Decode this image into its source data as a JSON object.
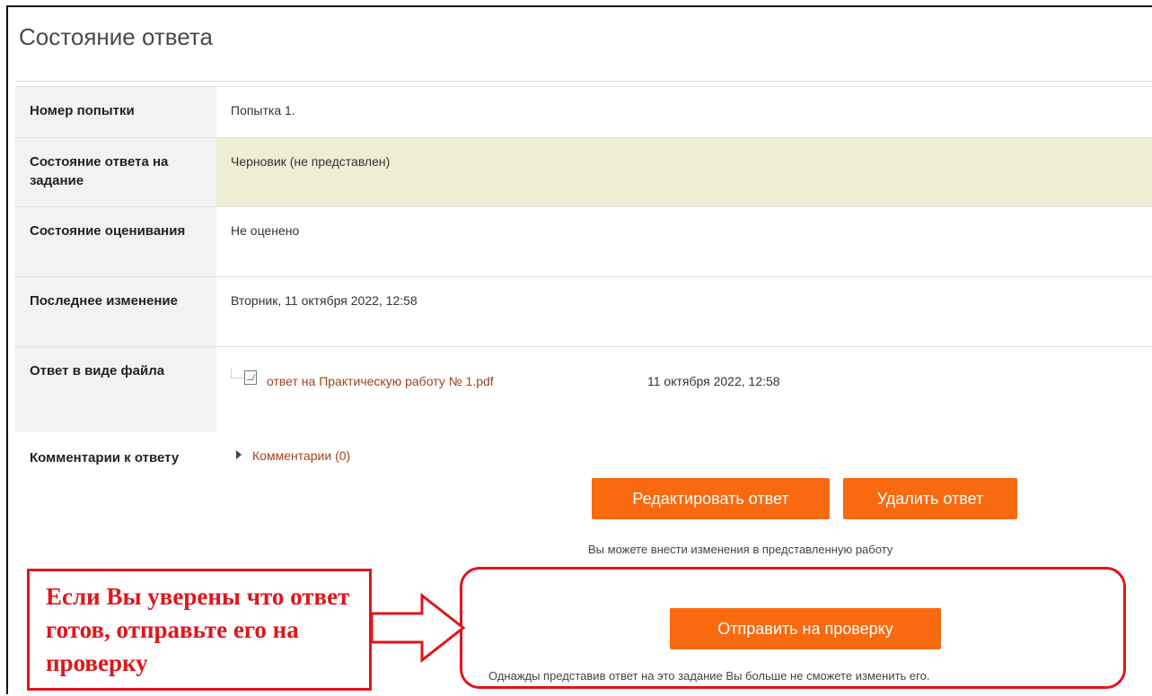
{
  "page": {
    "title": "Состояние ответа"
  },
  "rows": [
    {
      "label": "Номер попытки",
      "value": "Попытка 1."
    },
    {
      "label": "Состояние ответа на задание",
      "value": "Черновик (не представлен)"
    },
    {
      "label": "Состояние оценивания",
      "value": "Не оценено"
    },
    {
      "label": "Последнее изменение",
      "value": "Вторник, 11 октября 2022, 12:58"
    },
    {
      "label": "Ответ в виде файла"
    },
    {
      "label": "Комментарии к ответу"
    }
  ],
  "file": {
    "name": "ответ на Практическую работу № 1.pdf",
    "date": "11 октября 2022, 12:58",
    "icon": "pdf-file-icon"
  },
  "comments": {
    "label": "Комментарии (0)",
    "icon": "triangle-right-icon"
  },
  "actions": {
    "edit_label": "Редактировать ответ",
    "delete_label": "Удалить ответ",
    "edit_hint": "Вы можете внести изменения в представленную работу",
    "submit_label": "Отправить на проверку",
    "submit_hint": "Однажды представив ответ на это задание Вы больше не сможете изменить его."
  },
  "annotation": {
    "callout_text": "Если Вы уверены что ответ готов, отправьте его на проверку",
    "color": "#e0151b"
  },
  "colors": {
    "accent": "#f96a10",
    "link": "#a0421e",
    "draft_highlight": "#eeeed5",
    "label_bg": "#f2f2f2"
  }
}
